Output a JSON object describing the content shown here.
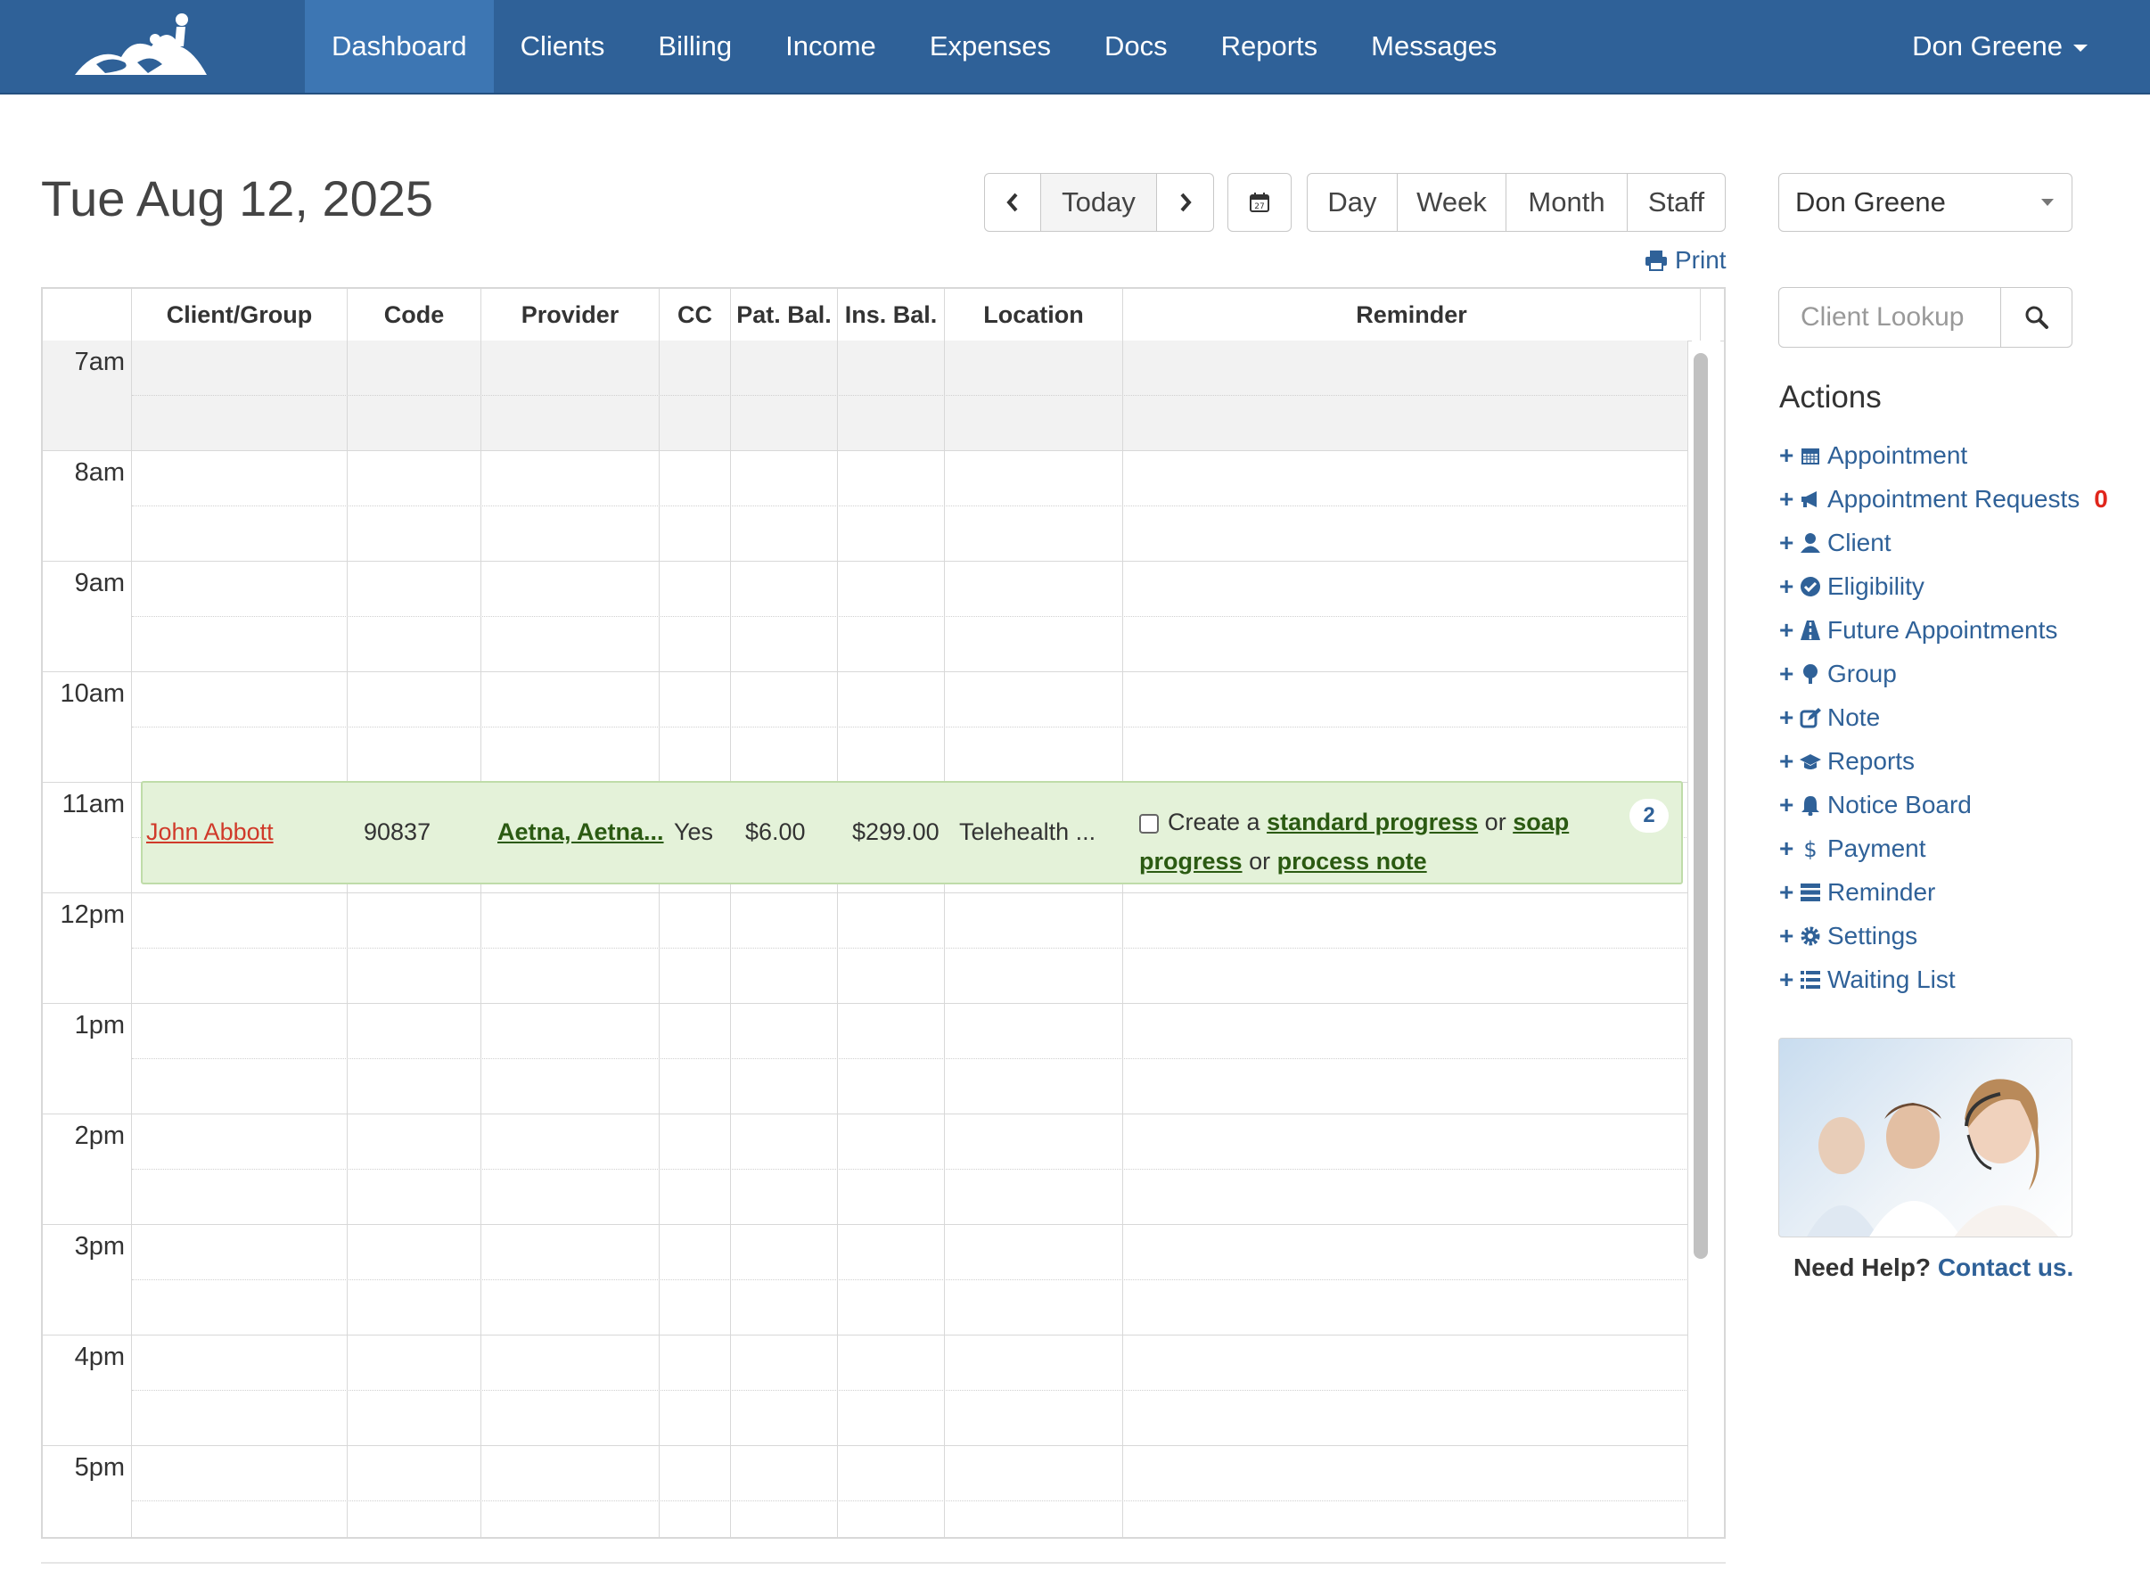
{
  "nav": {
    "items": [
      "Dashboard",
      "Clients",
      "Billing",
      "Income",
      "Expenses",
      "Docs",
      "Reports",
      "Messages"
    ],
    "active": "Dashboard",
    "user": "Don Greene"
  },
  "header": {
    "date": "Tue Aug 12, 2025",
    "today_label": "Today",
    "calendar_icon_day": "27",
    "views": [
      "Day",
      "Week",
      "Month",
      "Staff"
    ],
    "print_label": "Print"
  },
  "table": {
    "columns": [
      "Client/Group",
      "Code",
      "Provider",
      "CC",
      "Pat. Bal.",
      "Ins. Bal.",
      "Location",
      "Reminder"
    ],
    "hours": [
      "7am",
      "8am",
      "9am",
      "10am",
      "11am",
      "12pm",
      "1pm",
      "2pm",
      "3pm",
      "4pm",
      "5pm"
    ],
    "offhours": [
      "7am"
    ]
  },
  "appointment": {
    "hour": "11am",
    "client": "John Abbott",
    "code": "90837",
    "provider": "Aetna, Aetna...",
    "cc": "Yes",
    "pat_bal": "$6.00",
    "ins_bal": "$299.00",
    "location": "Telehealth ...",
    "reminder": {
      "prefix": "Create a",
      "link1": "standard progress",
      "or1": "or",
      "link2": "soap progress",
      "or2": "or",
      "link3": "process note"
    },
    "badge": "2",
    "color": "#e4f2d9"
  },
  "sidebar": {
    "staff_selected": "Don Greene",
    "lookup_placeholder": "Client Lookup",
    "actions_title": "Actions",
    "actions": [
      {
        "label": "Appointment",
        "icon": "calendar-icon"
      },
      {
        "label": "Appointment Requests",
        "icon": "megaphone-icon",
        "count": "0"
      },
      {
        "label": "Client",
        "icon": "user-icon"
      },
      {
        "label": "Eligibility",
        "icon": "check-circle-icon"
      },
      {
        "label": "Future Appointments",
        "icon": "road-icon"
      },
      {
        "label": "Group",
        "icon": "tree-icon"
      },
      {
        "label": "Note",
        "icon": "edit-icon"
      },
      {
        "label": "Reports",
        "icon": "graduation-cap-icon"
      },
      {
        "label": "Notice Board",
        "icon": "bell-icon"
      },
      {
        "label": "Payment",
        "icon": "dollar-icon"
      },
      {
        "label": "Reminder",
        "icon": "server-icon"
      },
      {
        "label": "Settings",
        "icon": "gear-icon"
      },
      {
        "label": "Waiting List",
        "icon": "list-icon"
      }
    ],
    "help_prefix": "Need Help?",
    "help_link": "Contact us."
  },
  "colors": {
    "navbar": "#2f6198",
    "nav_active": "#3d76b3",
    "link": "#2f6198",
    "client_link": "#d03a2a",
    "appt_bg": "#e4f2d9",
    "count": "#e0261c"
  }
}
